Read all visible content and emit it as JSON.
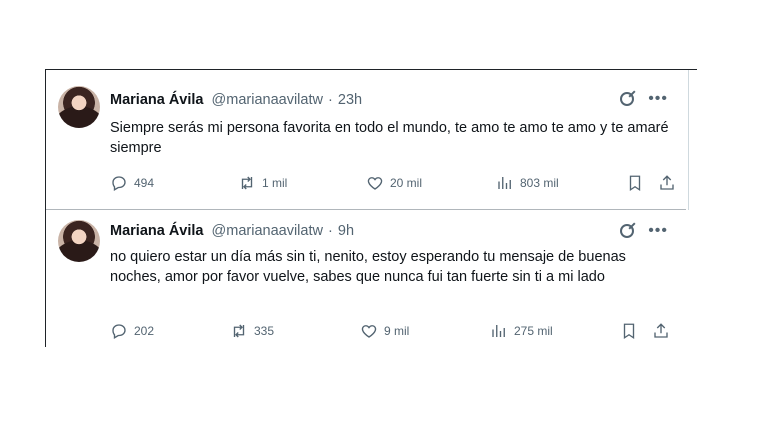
{
  "tweets": [
    {
      "author_name": "Mariana Ávila",
      "handle": "@marianaavilatw",
      "separator": "·",
      "time": "23h",
      "text": "Siempre serás mi persona favorita en todo el mundo, te amo te amo te amo y te amaré siempre",
      "replies": "494",
      "retweets": "1 mil",
      "likes": "20 mil",
      "views": "803 mil"
    },
    {
      "author_name": "Mariana Ávila",
      "handle": "@marianaavilatw",
      "separator": "·",
      "time": "9h",
      "text": "no quiero estar un día más sin ti, nenito, estoy esperando tu mensaje de buenas noches, amor por favor vuelve, sabes que nunca fui tan fuerte sin ti a mi lado",
      "replies": "202",
      "retweets": "335",
      "likes": "9 mil",
      "views": "275 mil"
    }
  ],
  "icons": {
    "reply": "reply-icon",
    "retweet": "retweet-icon",
    "like": "heart-icon",
    "views": "views-icon",
    "bookmark": "bookmark-icon",
    "share": "share-icon",
    "grok": "grok-icon",
    "more": "more-icon"
  }
}
